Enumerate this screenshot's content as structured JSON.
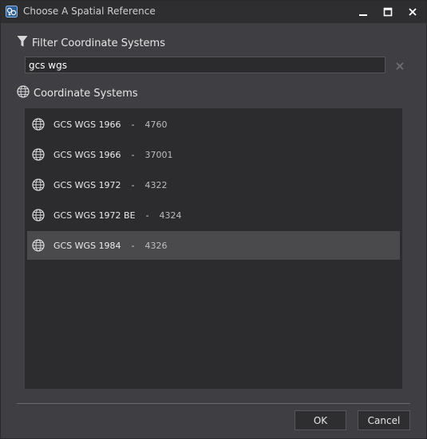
{
  "window": {
    "title": "Choose A Spatial Reference",
    "app_icon": "app-icon",
    "controls": [
      "minimize-icon",
      "maximize-icon",
      "close-icon"
    ]
  },
  "filter": {
    "label": "Filter Coordinate Systems",
    "icon": "filter-icon",
    "value": "gcs wgs",
    "clear_icon": "clear-icon"
  },
  "coordinate_systems": {
    "label": "Coordinate Systems",
    "icon": "globe-icon",
    "items": [
      {
        "name": "GCS WGS 1966",
        "sep": "-",
        "code": "4760",
        "selected": false
      },
      {
        "name": "GCS WGS 1966",
        "sep": "-",
        "code": "37001",
        "selected": false
      },
      {
        "name": "GCS WGS 1972",
        "sep": "-",
        "code": "4322",
        "selected": false
      },
      {
        "name": "GCS WGS 1972 BE",
        "sep": "-",
        "code": "4324",
        "selected": false
      },
      {
        "name": "GCS WGS 1984",
        "sep": "-",
        "code": "4326",
        "selected": true
      }
    ]
  },
  "buttons": {
    "ok": "OK",
    "cancel": "Cancel"
  },
  "colors": {
    "background": "#3f3f43",
    "titlebar": "#2e2e31",
    "list_background": "#2c2c2e",
    "selected_row": "#4a4a4d"
  }
}
